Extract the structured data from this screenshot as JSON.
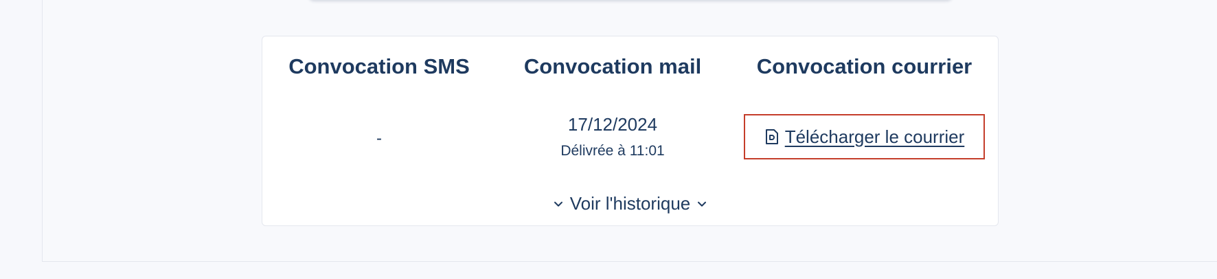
{
  "columns": {
    "sms": {
      "title": "Convocation SMS",
      "value": "-"
    },
    "mail": {
      "title": "Convocation mail",
      "date": "17/12/2024",
      "status": "Délivrée à 11:01"
    },
    "courrier": {
      "title": "Convocation courrier",
      "download_label": "Télécharger le courrier",
      "download_icon": "document-icon"
    }
  },
  "history": {
    "label": "Voir l'historique",
    "icon": "chevron-down-icon"
  },
  "colors": {
    "text": "#1e3a5f",
    "highlight_border": "#c43d2a",
    "background": "#f7f8fc",
    "card": "#ffffff"
  }
}
